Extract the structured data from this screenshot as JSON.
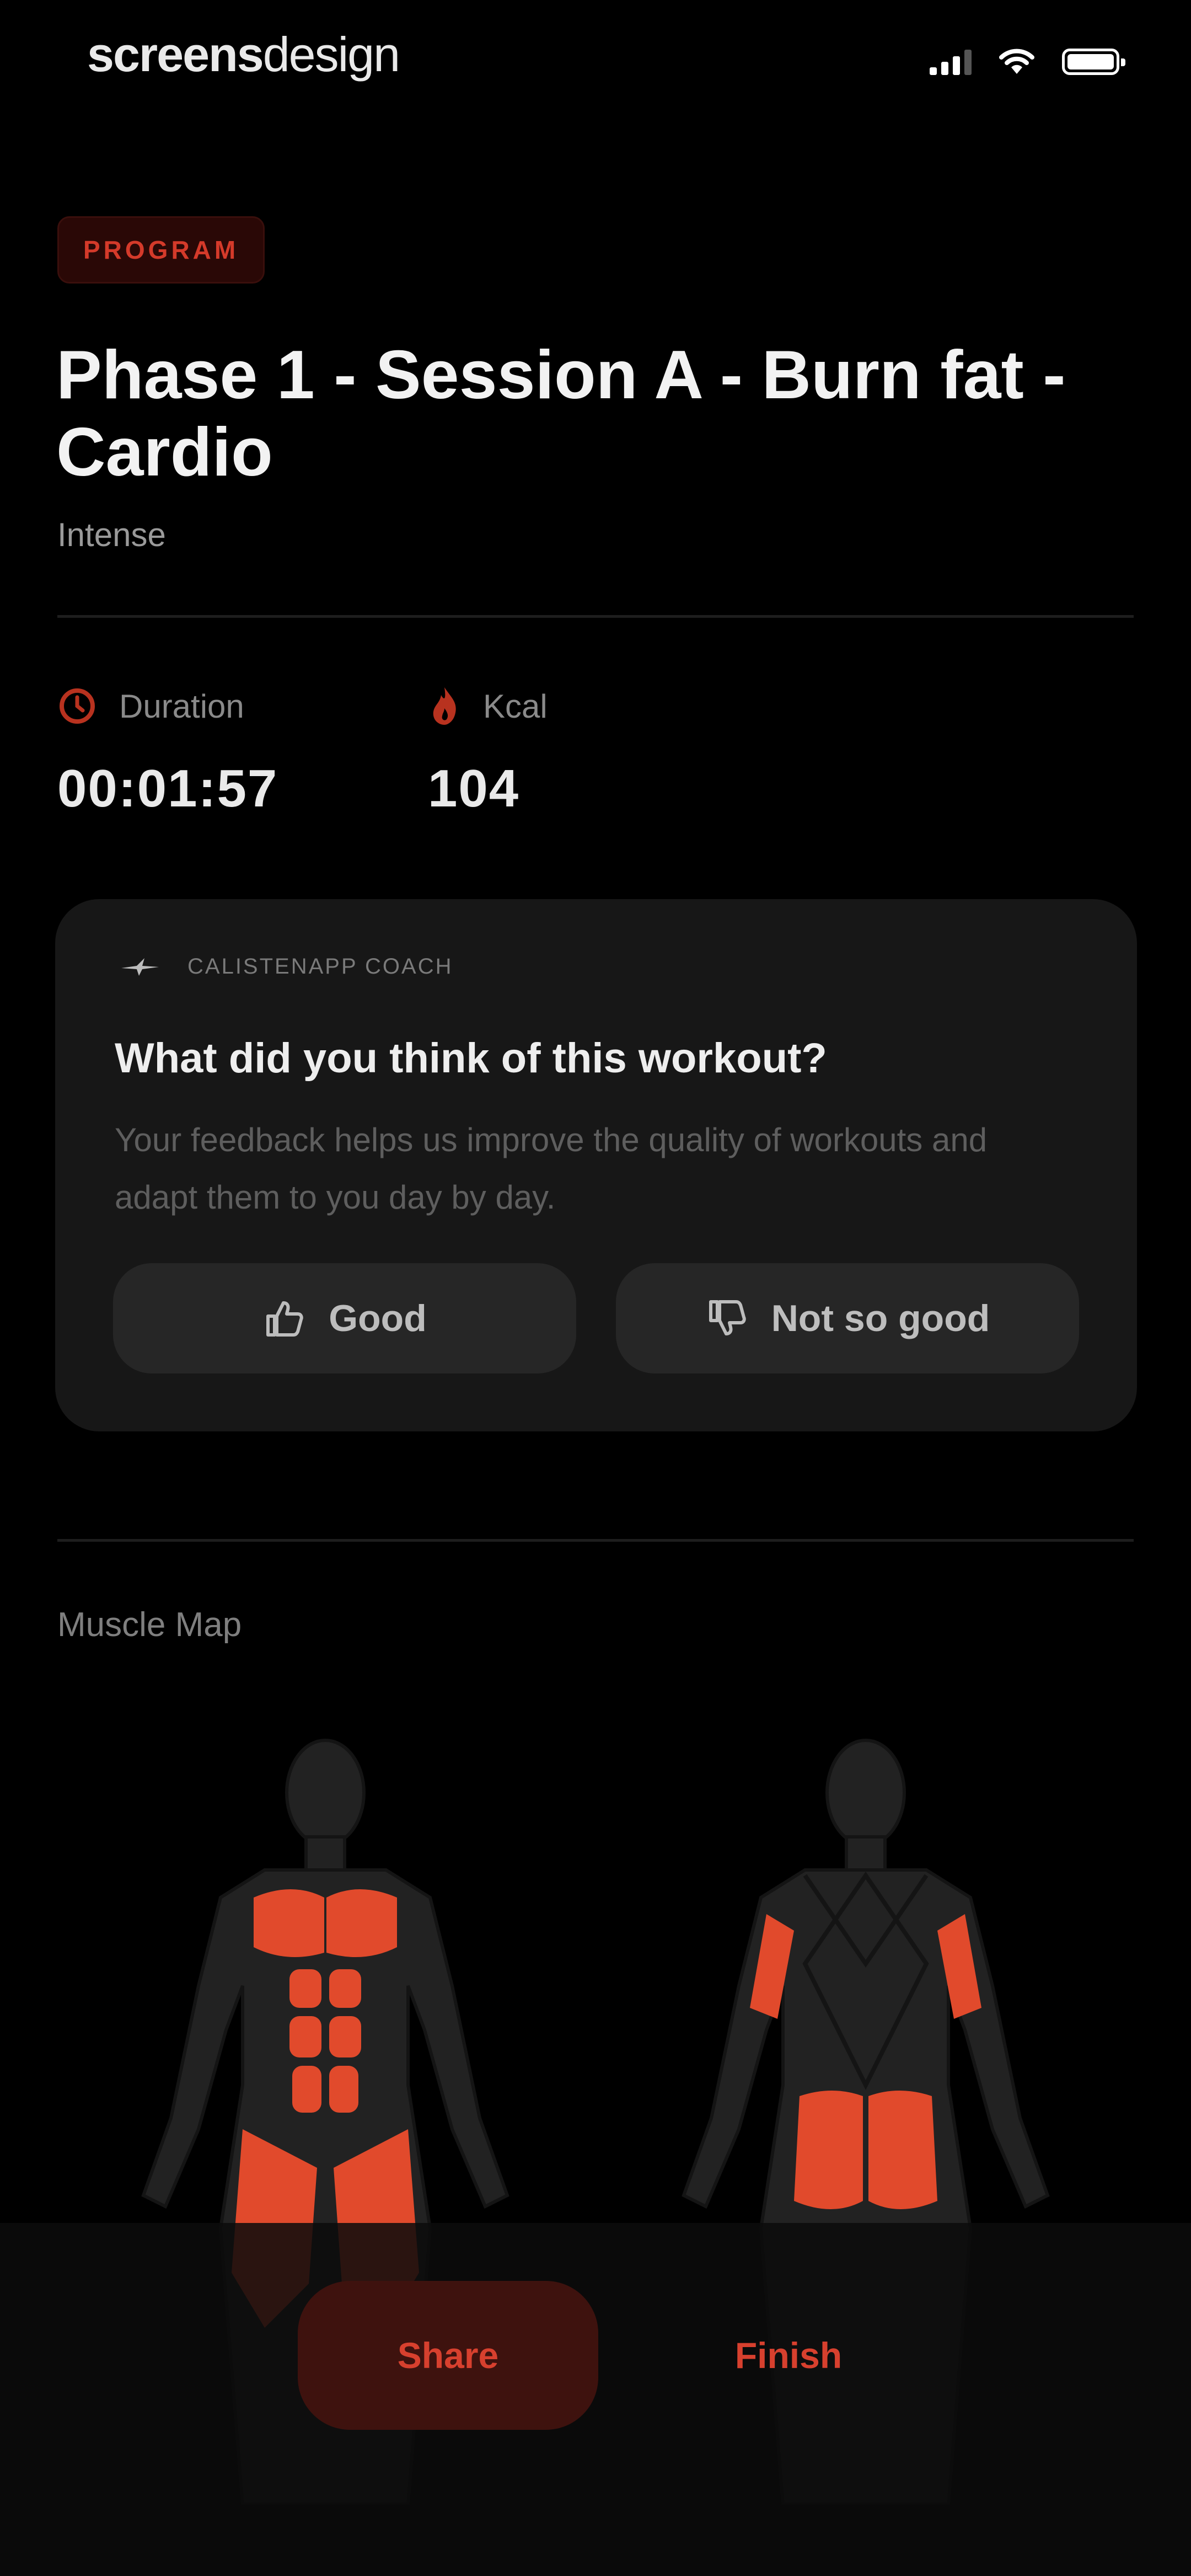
{
  "status_bar": {
    "brand_bold": "screens",
    "brand_light": "design"
  },
  "header": {
    "badge": "PROGRAM",
    "title": "Phase 1 - Session A - Burn fat - Cardio",
    "subtitle": "Intense"
  },
  "stats": [
    {
      "label": "Duration",
      "value": "00:01:57",
      "icon": "clock-icon"
    },
    {
      "label": "Kcal",
      "value": "104",
      "icon": "flame-icon"
    }
  ],
  "feedback": {
    "coach_label": "CALISTENAPP COACH",
    "question": "What did you think of this workout?",
    "description": "Your feedback helps us improve the quality of workouts and adapt them to you day by day.",
    "good_label": "Good",
    "bad_label": "Not so good"
  },
  "muscle_map": {
    "label": "Muscle Map",
    "highlight_color": "#e14a2c",
    "base_color": "#2a2a2a",
    "front_worked": [
      "chest",
      "abs",
      "quads"
    ],
    "back_worked": [
      "triceps",
      "glutes"
    ]
  },
  "actions": {
    "share_label": "Share",
    "finish_label": "Finish"
  },
  "colors": {
    "accent": "#d7402e",
    "background": "#000000",
    "card": "#171717"
  }
}
